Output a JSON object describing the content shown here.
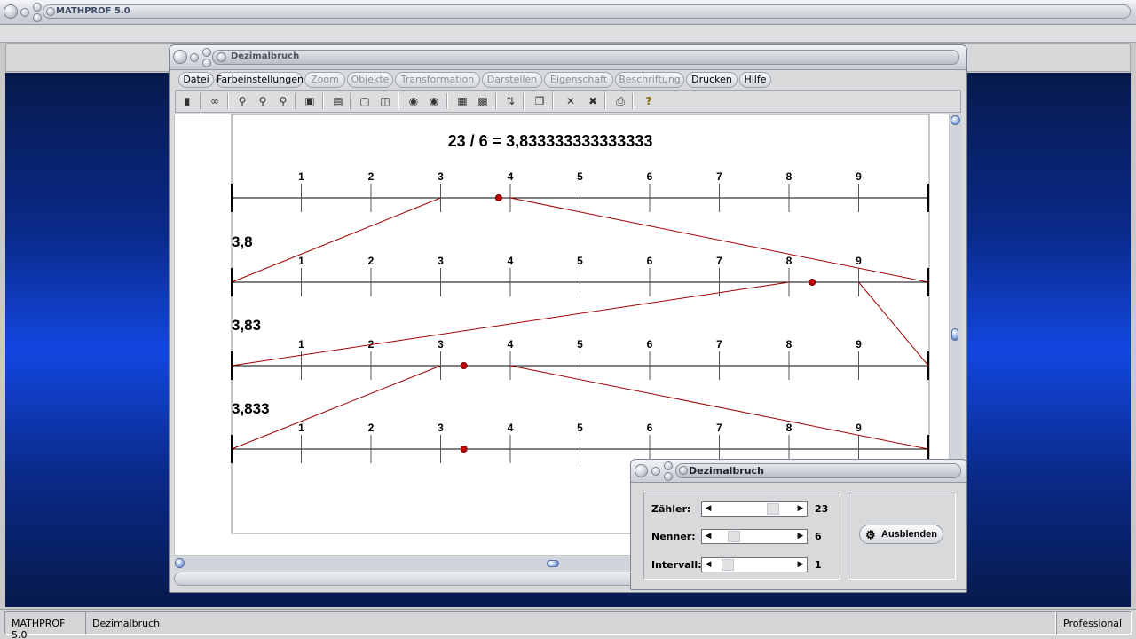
{
  "app": {
    "title": "MATHPROF 5.0"
  },
  "document": {
    "title": "Dezimalbruch",
    "menu": [
      {
        "label": "Datei",
        "enabled": true
      },
      {
        "label": "Farbeinstellungen",
        "enabled": true
      },
      {
        "label": "Zoom",
        "enabled": false
      },
      {
        "label": "Objekte",
        "enabled": false
      },
      {
        "label": "Transformation",
        "enabled": false
      },
      {
        "label": "Darstellen",
        "enabled": false
      },
      {
        "label": "Eigenschaft",
        "enabled": false
      },
      {
        "label": "Beschriftung",
        "enabled": false
      },
      {
        "label": "Drucken",
        "enabled": true
      },
      {
        "label": "Hilfe",
        "enabled": true
      }
    ],
    "toolbar_icons": [
      "exit-icon",
      "glasses-icon",
      "zoom-out-icon",
      "zoom-reset-icon",
      "zoom-in-icon",
      "properties-icon",
      "window-icon",
      "frame-icon",
      "grid-icon",
      "copy-image-icon",
      "save-image-icon",
      "table-icon",
      "export-icon",
      "transfer-icon",
      "pages-icon",
      "delete-icon",
      "delete-all-icon",
      "print-icon",
      "help-icon"
    ]
  },
  "figure": {
    "heading": "23 / 6 = 3,833333333333333",
    "tick_labels": [
      "1",
      "2",
      "3",
      "4",
      "5",
      "6",
      "7",
      "8",
      "9"
    ],
    "line_color": "#000000",
    "highlight_color": "#a00000",
    "rows": [
      {
        "label": "",
        "point": 3.8333
      },
      {
        "label": "3,8",
        "point": 8.333
      },
      {
        "label": "3,83",
        "point": 3.333
      },
      {
        "label": "3,833",
        "point": 3.333
      }
    ]
  },
  "dialog": {
    "title": "Dezimalbruch",
    "fields": [
      {
        "label": "Zähler:",
        "value": "23",
        "position": 0.78
      },
      {
        "label": "Nenner:",
        "value": "6",
        "position": 0.2
      },
      {
        "label": "Intervall:",
        "value": "1",
        "position": 0.1
      }
    ],
    "hide_button": "Ausblenden"
  },
  "status": {
    "app": "MATHPROF 5.0",
    "window": "Dezimalbruch",
    "edition": "Professional"
  }
}
